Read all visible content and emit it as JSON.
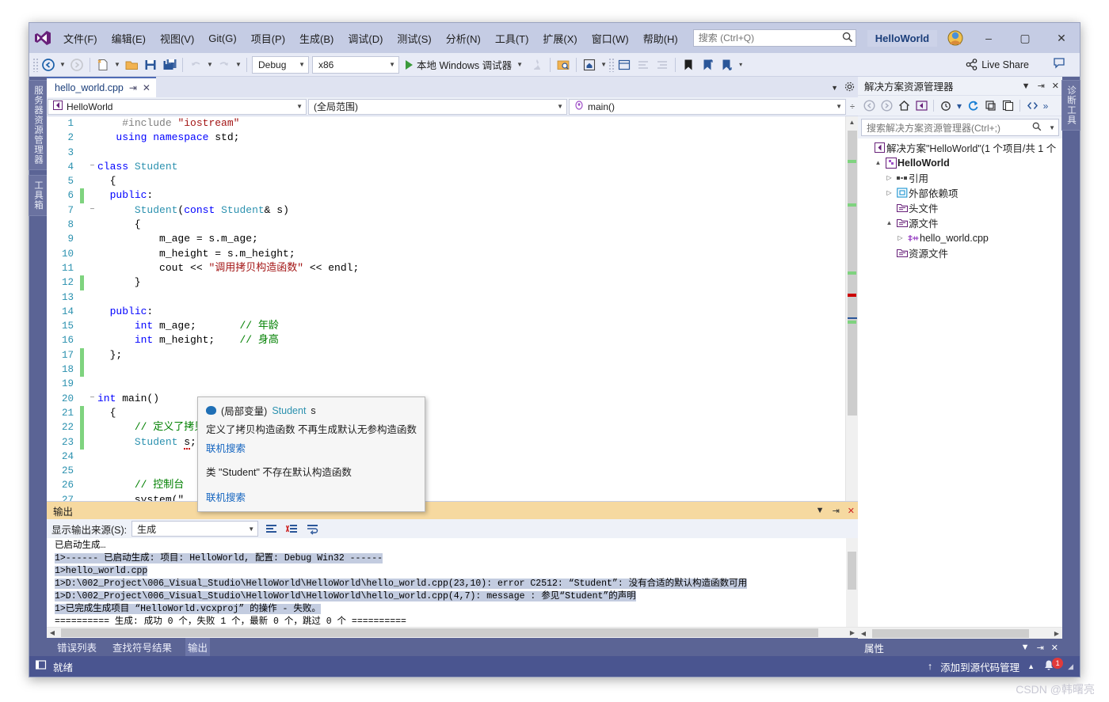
{
  "window": {
    "app_title": "HelloWorld",
    "minimize": "–",
    "maximize": "▢",
    "close": "✕"
  },
  "menu": {
    "items": [
      {
        "label": "文件(F)"
      },
      {
        "label": "编辑(E)"
      },
      {
        "label": "视图(V)"
      },
      {
        "label": "Git(G)"
      },
      {
        "label": "项目(P)"
      },
      {
        "label": "生成(B)"
      },
      {
        "label": "调试(D)"
      },
      {
        "label": "测试(S)"
      },
      {
        "label": "分析(N)"
      },
      {
        "label": "工具(T)"
      },
      {
        "label": "扩展(X)"
      },
      {
        "label": "窗口(W)"
      },
      {
        "label": "帮助(H)"
      }
    ]
  },
  "search": {
    "placeholder": "搜索 (Ctrl+Q)",
    "value": ""
  },
  "toolbar": {
    "config": "Debug",
    "platform": "x86",
    "run_label": "本地 Windows 调试器",
    "live_share": "Live Share"
  },
  "left_sidebar": {
    "tabs": [
      "服务器资源管理器",
      "工具箱"
    ]
  },
  "right_sidebar": {
    "tabs": [
      "诊断工具"
    ]
  },
  "editor": {
    "tab_label": "hello_world.cpp",
    "nav": {
      "project": "HelloWorld",
      "scope": "(全局范围)",
      "member": "main()"
    },
    "lines": [
      {
        "n": 1,
        "change": "",
        "fold": "",
        "html": "    <span class=\"pre\">#include</span> <span class=\"str\">\"iostream\"</span>"
      },
      {
        "n": 2,
        "change": "",
        "fold": "",
        "html": "   <span class=\"kw\">using namespace</span> std;"
      },
      {
        "n": 3,
        "change": "",
        "fold": "",
        "html": ""
      },
      {
        "n": 4,
        "change": "",
        "fold": "−",
        "html": "<span class=\"kw\">class</span> <span class=\"type\">Student</span>"
      },
      {
        "n": 5,
        "change": "",
        "fold": "",
        "html": "  {"
      },
      {
        "n": 6,
        "change": "green",
        "fold": "",
        "html": "  <span class=\"kw\">public</span>:"
      },
      {
        "n": 7,
        "change": "",
        "fold": "−",
        "html": "      <span class=\"type\">Student</span>(<span class=\"kw\">const</span> <span class=\"type\">Student</span>&amp; s)"
      },
      {
        "n": 8,
        "change": "",
        "fold": "",
        "html": "      {"
      },
      {
        "n": 9,
        "change": "",
        "fold": "",
        "html": "          m_age = s.m_age;"
      },
      {
        "n": 10,
        "change": "",
        "fold": "",
        "html": "          m_height = s.m_height;"
      },
      {
        "n": 11,
        "change": "",
        "fold": "",
        "html": "          cout &lt;&lt; <span class=\"str\">\"调用拷贝构造函数\"</span> &lt;&lt; endl;"
      },
      {
        "n": 12,
        "change": "green",
        "fold": "",
        "html": "      }"
      },
      {
        "n": 13,
        "change": "",
        "fold": "",
        "html": ""
      },
      {
        "n": 14,
        "change": "",
        "fold": "",
        "html": "  <span class=\"kw\">public</span>:"
      },
      {
        "n": 15,
        "change": "",
        "fold": "",
        "html": "      <span class=\"kw\">int</span> m_age;       <span class=\"cmt\">// 年龄</span>"
      },
      {
        "n": 16,
        "change": "",
        "fold": "",
        "html": "      <span class=\"kw\">int</span> m_height;    <span class=\"cmt\">// 身高</span>"
      },
      {
        "n": 17,
        "change": "green",
        "fold": "",
        "html": "  };"
      },
      {
        "n": 18,
        "change": "green",
        "fold": "",
        "html": ""
      },
      {
        "n": 19,
        "change": "",
        "fold": "",
        "html": ""
      },
      {
        "n": 20,
        "change": "",
        "fold": "−",
        "html": "<span class=\"kw\">int</span> main()"
      },
      {
        "n": 21,
        "change": "green",
        "fold": "",
        "html": "  {"
      },
      {
        "n": 22,
        "change": "green",
        "fold": "",
        "html": "      <span class=\"cmt\">// 定义了拷贝构造函数 不再生成默认无参构造函数</span>"
      },
      {
        "n": 23,
        "change": "green",
        "fold": "",
        "html": "      <span class=\"type\">Student</span> <span class=\"squig\">s</span>;"
      },
      {
        "n": 24,
        "change": "",
        "fold": "",
        "html": ""
      },
      {
        "n": 25,
        "change": "",
        "fold": "",
        "html": ""
      },
      {
        "n": 26,
        "change": "",
        "fold": "",
        "html": "      <span class=\"cmt\">// 控制台</span>"
      },
      {
        "n": 27,
        "change": "",
        "fold": "",
        "html": "      system(\""
      }
    ]
  },
  "tooltip": {
    "kind": "(局部变量)",
    "type": "Student",
    "name": "s",
    "message1": "定义了拷贝构造函数 不再生成默认无参构造函数",
    "link1": "联机搜索",
    "message2": "类 \"Student\" 不存在默认构造函数",
    "link2": "联机搜索"
  },
  "solution_explorer": {
    "title": "解决方案资源管理器",
    "search_placeholder": "搜索解决方案资源管理器(Ctrl+;)",
    "tree": [
      {
        "indent": 0,
        "expander": "",
        "icon": "solution-icon",
        "label": "解决方案\"HelloWorld\"(1 个项目/共 1 个",
        "bold": false
      },
      {
        "indent": 1,
        "expander": "▲",
        "icon": "project-icon",
        "label": "HelloWorld",
        "bold": true
      },
      {
        "indent": 2,
        "expander": "▷",
        "icon": "references-icon",
        "label": "引用",
        "bold": false
      },
      {
        "indent": 2,
        "expander": "▷",
        "icon": "dependency-icon",
        "label": "外部依赖项",
        "bold": false
      },
      {
        "indent": 2,
        "expander": "",
        "icon": "folder-icon",
        "label": "头文件",
        "bold": false
      },
      {
        "indent": 2,
        "expander": "▲",
        "icon": "folder-icon",
        "label": "源文件",
        "bold": false
      },
      {
        "indent": 3,
        "expander": "▷",
        "icon": "cpp-file-icon",
        "label": "hello_world.cpp",
        "bold": false
      },
      {
        "indent": 2,
        "expander": "",
        "icon": "folder-icon",
        "label": "资源文件",
        "bold": false
      }
    ]
  },
  "properties_panel": {
    "title": "属性"
  },
  "output_panel": {
    "title": "输出",
    "source_label": "显示输出来源(S):",
    "source_value": "生成",
    "lines": [
      "已启动生成…",
      "1>------ 已启动生成: 项目: HelloWorld, 配置: Debug Win32 ------",
      "1>hello_world.cpp",
      "1>D:\\002_Project\\006_Visual_Studio\\HelloWorld\\HelloWorld\\hello_world.cpp(23,10): error C2512: “Student”: 没有合适的默认构造函数可用",
      "1>D:\\002_Project\\006_Visual_Studio\\HelloWorld\\HelloWorld\\hello_world.cpp(4,7): message : 参见“Student”的声明",
      "1>已完成生成项目 “HelloWorld.vcxproj” 的操作 - 失败。",
      "========== 生成: 成功 0 个，失败 1 个，最新 0 个，跳过 0 个 =========="
    ]
  },
  "bottom_tabs": {
    "items": [
      {
        "label": "错误列表",
        "active": false
      },
      {
        "label": "查找符号结果",
        "active": false
      },
      {
        "label": "输出",
        "active": true
      }
    ]
  },
  "statusbar": {
    "status": "就绪",
    "source_control": "添加到源代码管理",
    "notification_count": "1"
  },
  "watermark": {
    "text": "CSDN @韩曙亮"
  },
  "colors": {
    "accent": "#5b6495",
    "titlebar": "#c5cce4",
    "output_title": "#f6d9a0",
    "status": "#4a5590",
    "keyword": "#0000ff",
    "type": "#2b91af",
    "string": "#a31515",
    "comment": "#008000",
    "change_marker": "#7fd37f",
    "error": "#cc0000"
  }
}
